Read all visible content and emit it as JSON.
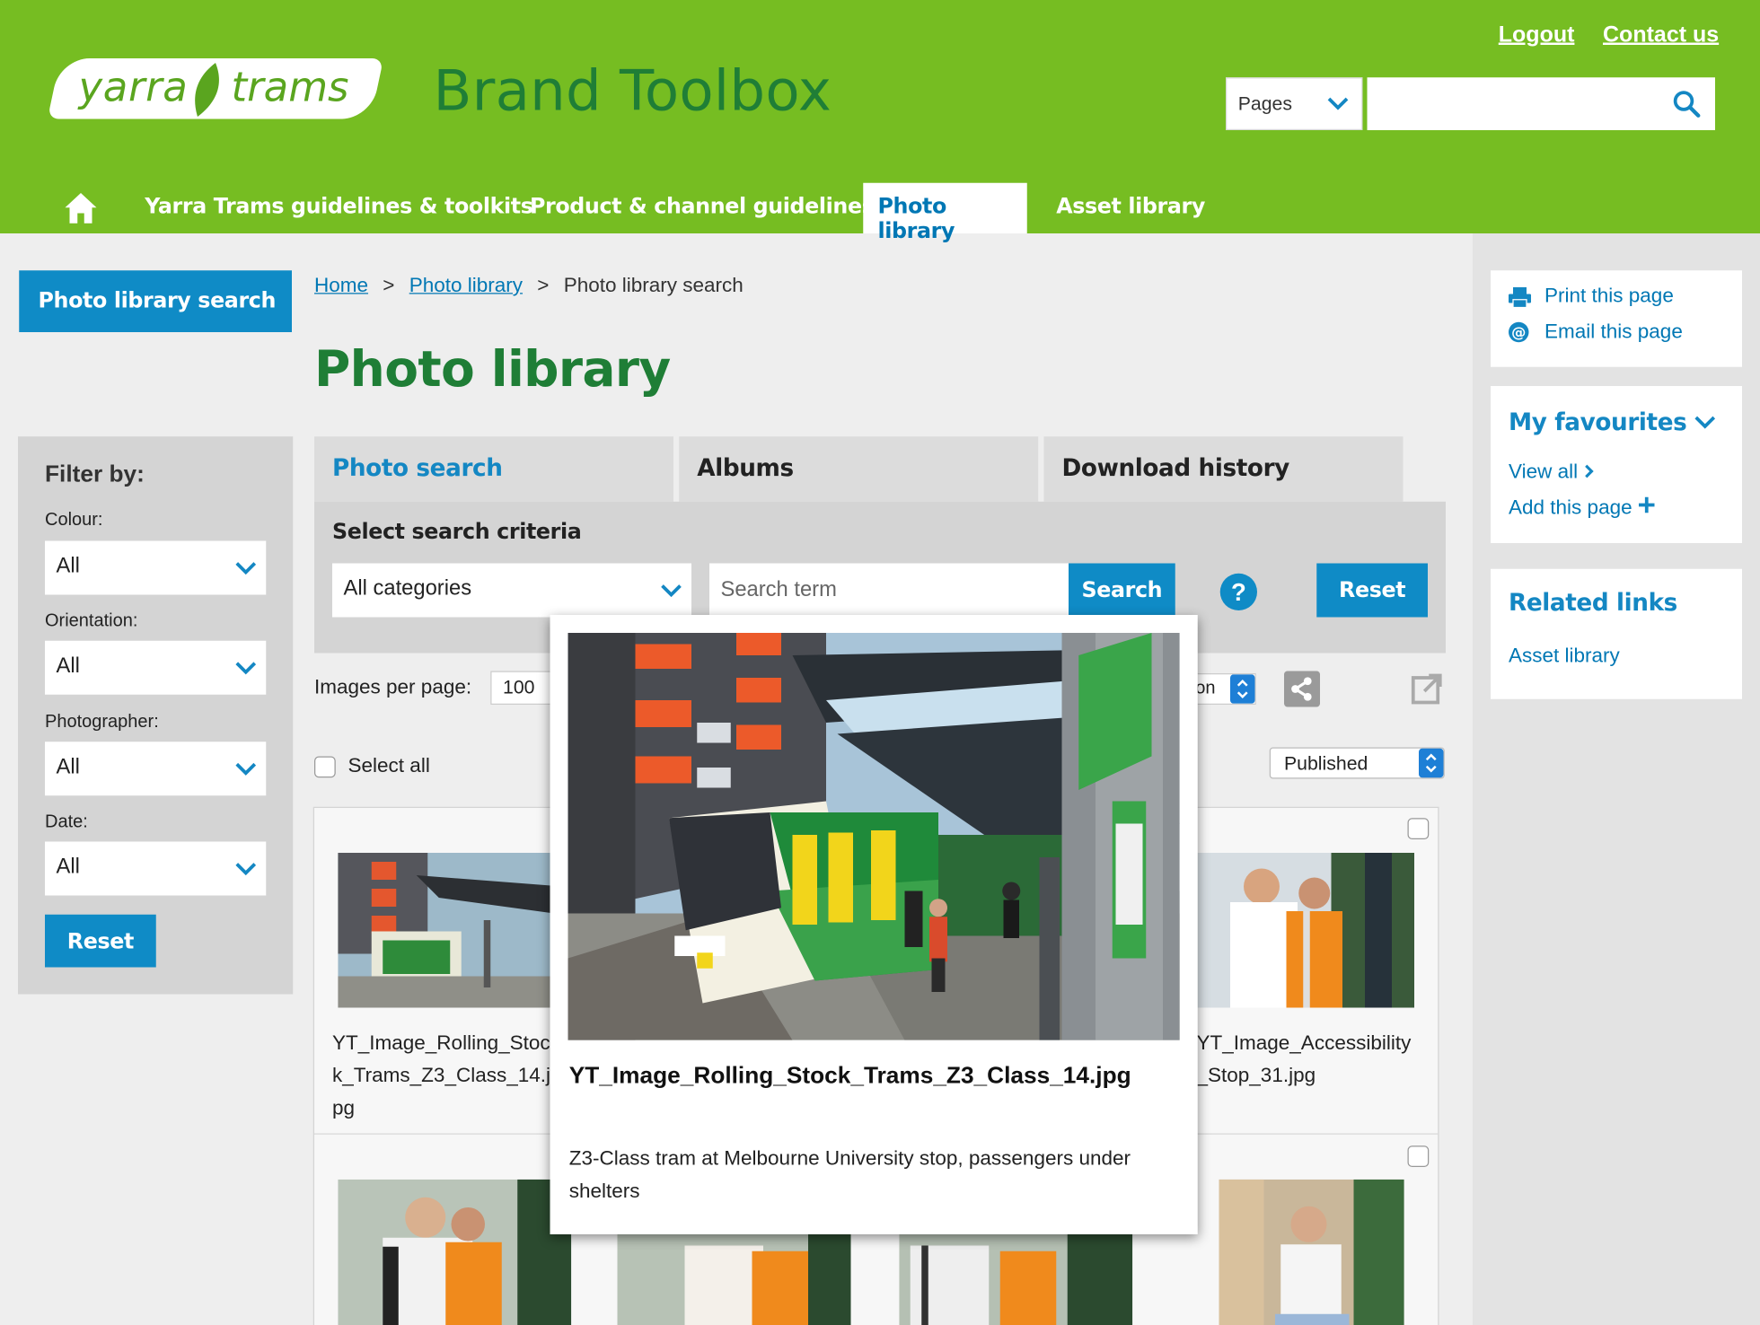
{
  "header": {
    "logo_part1": "yarra",
    "logo_part2": "trams",
    "site_title": "Brand Toolbox",
    "logout": "Logout",
    "contact": "Contact us",
    "search_type": "Pages",
    "search_value": ""
  },
  "nav": {
    "items": [
      {
        "label": "Yarra Trams guidelines & toolkits"
      },
      {
        "label": "Product & channel guidelines"
      },
      {
        "label": "Photo library"
      },
      {
        "label": "Asset library"
      }
    ]
  },
  "sidebar": {
    "title": "Photo library search",
    "filter_title": "Filter by:",
    "filters": [
      {
        "label": "Colour:",
        "value": "All"
      },
      {
        "label": "Orientation:",
        "value": "All"
      },
      {
        "label": "Photographer:",
        "value": "All"
      },
      {
        "label": "Date:",
        "value": "All"
      }
    ],
    "reset": "Reset"
  },
  "breadcrumb": {
    "home": "Home",
    "sep": ">",
    "photo_library": "Photo library",
    "current": "Photo library search"
  },
  "page_title": "Photo library",
  "tabs": [
    {
      "label": "Photo search"
    },
    {
      "label": "Albums"
    },
    {
      "label": "Download history"
    }
  ],
  "criteria": {
    "title": "Select search criteria",
    "category": "All categories",
    "term_placeholder": "Search term",
    "search": "Search",
    "help": "?",
    "reset": "Reset"
  },
  "results": {
    "ipp_label": "Images per page:",
    "ipp_value": "100",
    "sort_value": "on",
    "select_all": "Select all",
    "status_value": "Published",
    "items": [
      {
        "filename": "YT_Image_Rolling_Stock_Trams_Z3_Class_14.jpg"
      },
      {
        "filename": "YT_Image_Accessibility_Stop_31.jpg"
      }
    ]
  },
  "right": {
    "print": "Print this page",
    "email": "Email this page",
    "favourites": "My favourites",
    "view_all": "View all",
    "add_page": "Add this page",
    "related": "Related links",
    "asset_library": "Asset library"
  },
  "popup": {
    "filename": "YT_Image_Rolling_Stock_Trams_Z3_Class_14.jpg",
    "description": "Z3-Class tram at Melbourne University stop, passengers under shelters"
  },
  "colors": {
    "header_green": "#76bd22",
    "title_green": "#1f7e36",
    "brand_blue": "#0f8bc6",
    "link_blue": "#0077b4"
  }
}
